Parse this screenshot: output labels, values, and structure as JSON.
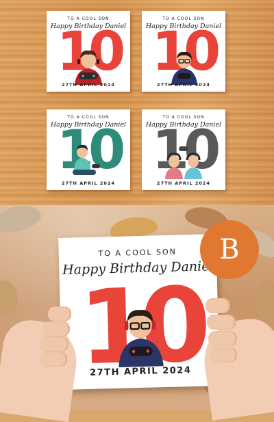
{
  "cards": [
    {
      "line1": "TO A COOL SON",
      "line2": "Happy Birthday Daniel",
      "number": "10",
      "date": "27TH APRIL 2024",
      "color": "#e8443a",
      "figure": "gamer-boy-controller-icon"
    },
    {
      "line1": "TO A COOL SON",
      "line2": "Happy Birthday Daniel",
      "number": "10",
      "date": "27TH APRIL 2024",
      "color": "#e8443a",
      "figure": "gamer-boy-glasses-icon"
    },
    {
      "line1": "TO A COOL SON",
      "line2": "Happy Birthday Daniel",
      "number": "10",
      "date": "27TH APRIL 2024",
      "color": "#2f8c7a",
      "figure": "boy-sitting-gaming-icon"
    },
    {
      "line1": "TO A COOL SON",
      "line2": "Happy Birthday Daniel",
      "number": "10",
      "date": "27TH APRIL 2024",
      "color": "#5a5a5a",
      "figure": "two-boys-headsets-icon"
    }
  ],
  "featured": {
    "line1": "TO A COOL SON",
    "line2": "Happy Birthday Daniel",
    "number": "10",
    "date": "27TH APRIL 2024",
    "color": "#e8443a",
    "figure": "gamer-boy-glasses-icon"
  },
  "badge": {
    "label": "B",
    "color": "#e07832"
  }
}
